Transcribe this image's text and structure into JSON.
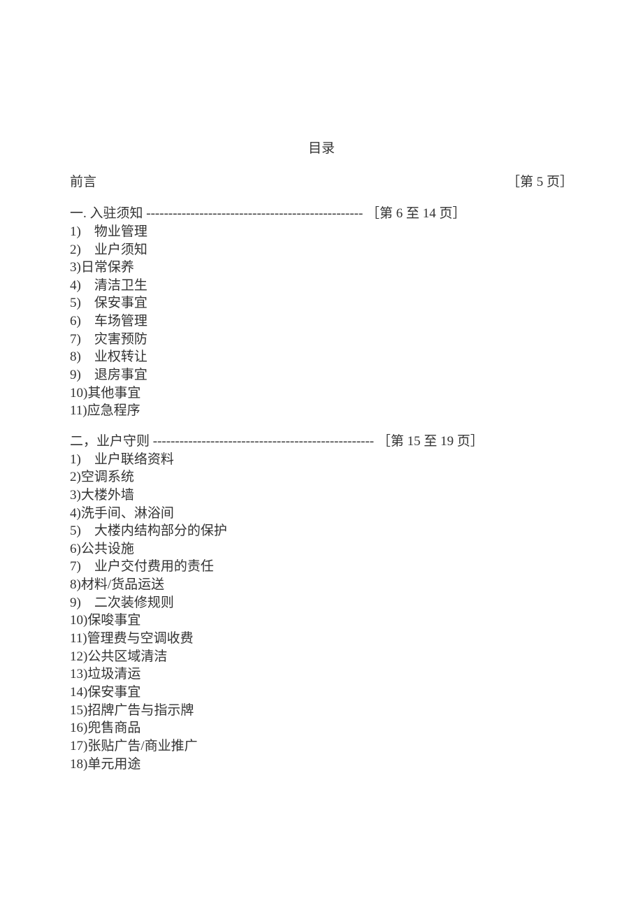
{
  "title": "目录",
  "preface": {
    "label": "前言",
    "page": "［第 5 页］"
  },
  "section1": {
    "heading": "一. 入驻须知 ",
    "dashes": "-------------------------------------------------",
    "page": " ［第 6 至 14 页］",
    "items": [
      "1)    物业管理",
      "2)    业户须知",
      "3)日常保养",
      "4)    清洁卫生",
      "5)    保安事宜",
      "6)    车场管理",
      "7)    灾害预防",
      "8)    业权转让",
      "9)    退房事宜",
      "10)其他事宜",
      "11)应急程序"
    ]
  },
  "section2": {
    "heading": "二，业户守则 ",
    "dashes": "--------------------------------------------------",
    "page": " ［第 15 至 19 页］",
    "items": [
      "1)    业户联络资料",
      "2)空调系统",
      "3)大楼外墙",
      "4)洗手间、淋浴间",
      "5)    大楼内结构部分的保护",
      "6)公共设施",
      "7)    业户交付费用的责任",
      "8)材料/货品运送",
      "9)    二次装修规则",
      "10)保唆事宜",
      "11)管理费与空调收费",
      "12)公共区域清洁",
      "13)垃圾清运",
      "14)保安事宜",
      "15)招牌广告与指示牌",
      "16)兜售商品",
      "17)张贴广告/商业推广",
      "18)单元用途"
    ]
  }
}
